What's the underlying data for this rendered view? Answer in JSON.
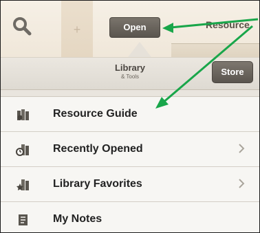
{
  "toolbar": {
    "open_label": "Open",
    "resource_title": "Resource",
    "plus_label": "+"
  },
  "popover": {
    "title": "Library",
    "subtitle": "& Tools",
    "store_label": "Store"
  },
  "list": {
    "items": [
      {
        "label": "Resource Guide",
        "icon": "resource-guide-icon",
        "has_chevron": false
      },
      {
        "label": "Recently Opened",
        "icon": "recently-opened-icon",
        "has_chevron": true
      },
      {
        "label": "Library Favorites",
        "icon": "library-favorites-icon",
        "has_chevron": true
      },
      {
        "label": "My Notes",
        "icon": "notes-icon",
        "has_chevron": false
      }
    ]
  },
  "annotation": {
    "arrow_color": "#19a64a"
  }
}
